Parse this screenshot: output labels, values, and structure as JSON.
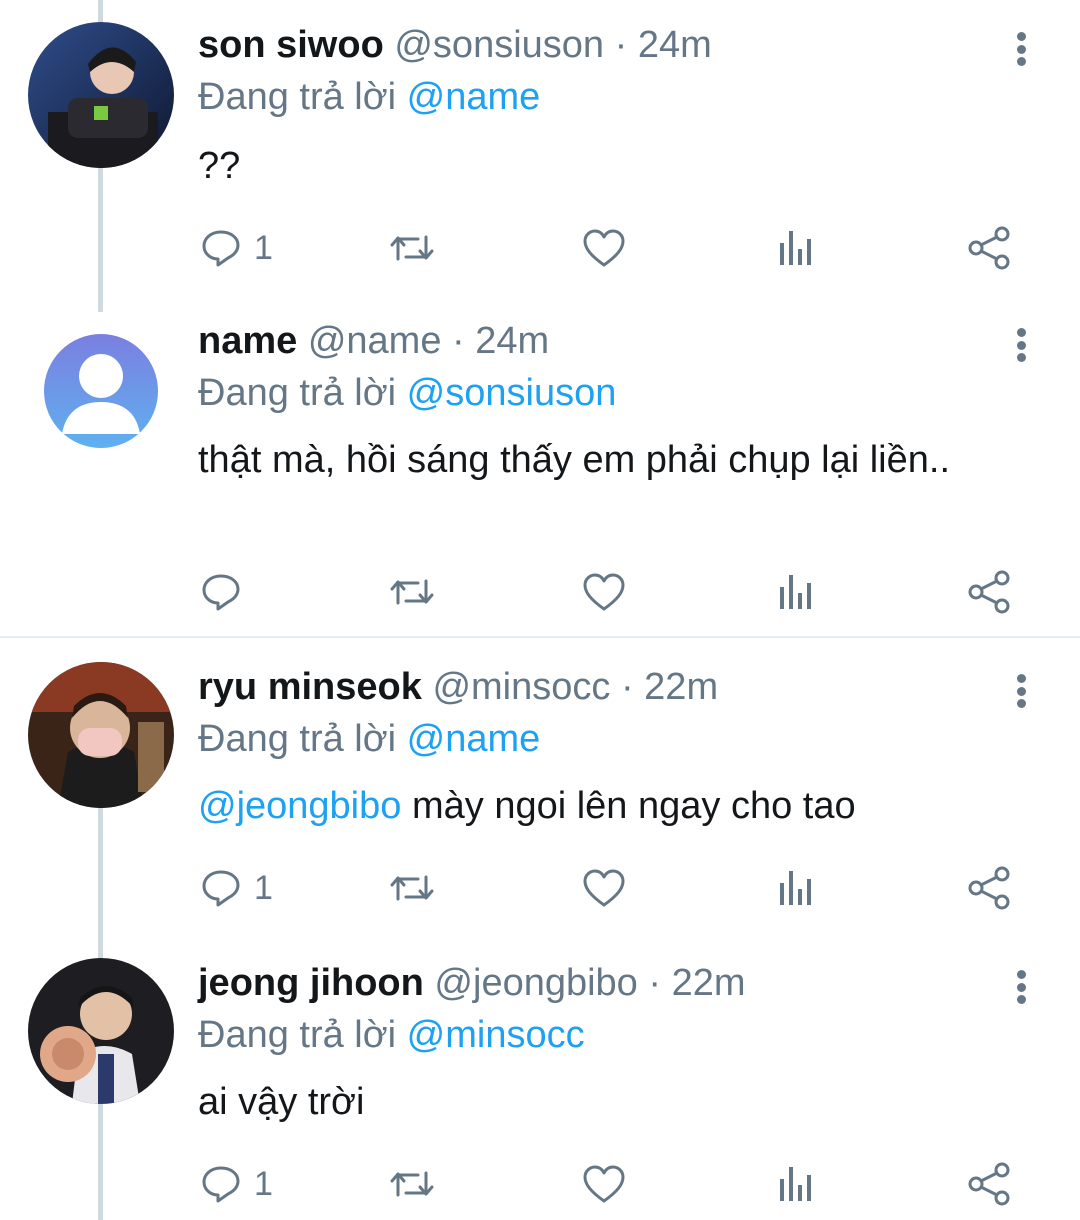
{
  "tweets": [
    {
      "display_name": "son siwoo",
      "handle": "@sonsiuson",
      "sep": "·",
      "time": "24m",
      "reply_prefix": "Đang trả lời",
      "reply_to": "@name",
      "text": "??",
      "reply_count": "1"
    },
    {
      "display_name": "name",
      "handle": "@name",
      "sep": "·",
      "time": "24m",
      "reply_prefix": "Đang trả lời",
      "reply_to": "@sonsiuson",
      "text": "thật mà, hồi sáng thấy em phải chụp lại liền..",
      "reply_count": ""
    },
    {
      "display_name": "ryu minseok",
      "handle": "@minsocc",
      "sep": "·",
      "time": "22m",
      "reply_prefix": "Đang trả lời",
      "reply_to": "@name",
      "text_mention": "@jeongbibo",
      "text": "mày ngoi lên ngay cho tao",
      "reply_count": "1"
    },
    {
      "display_name": "jeong jihoon",
      "handle": "@jeongbibo",
      "sep": "·",
      "time": "22m",
      "reply_prefix": "Đang trả lời",
      "reply_to": "@minsocc",
      "text": "ai vậy trời",
      "reply_count": "1"
    }
  ],
  "colors": {
    "text_primary": "#14171a",
    "text_secondary": "#657786",
    "accent": "#1da1f2",
    "thread_line": "#cfd9de"
  },
  "icons": [
    "reply-icon",
    "retweet-icon",
    "like-icon",
    "analytics-icon",
    "share-icon",
    "more-options-icon"
  ]
}
